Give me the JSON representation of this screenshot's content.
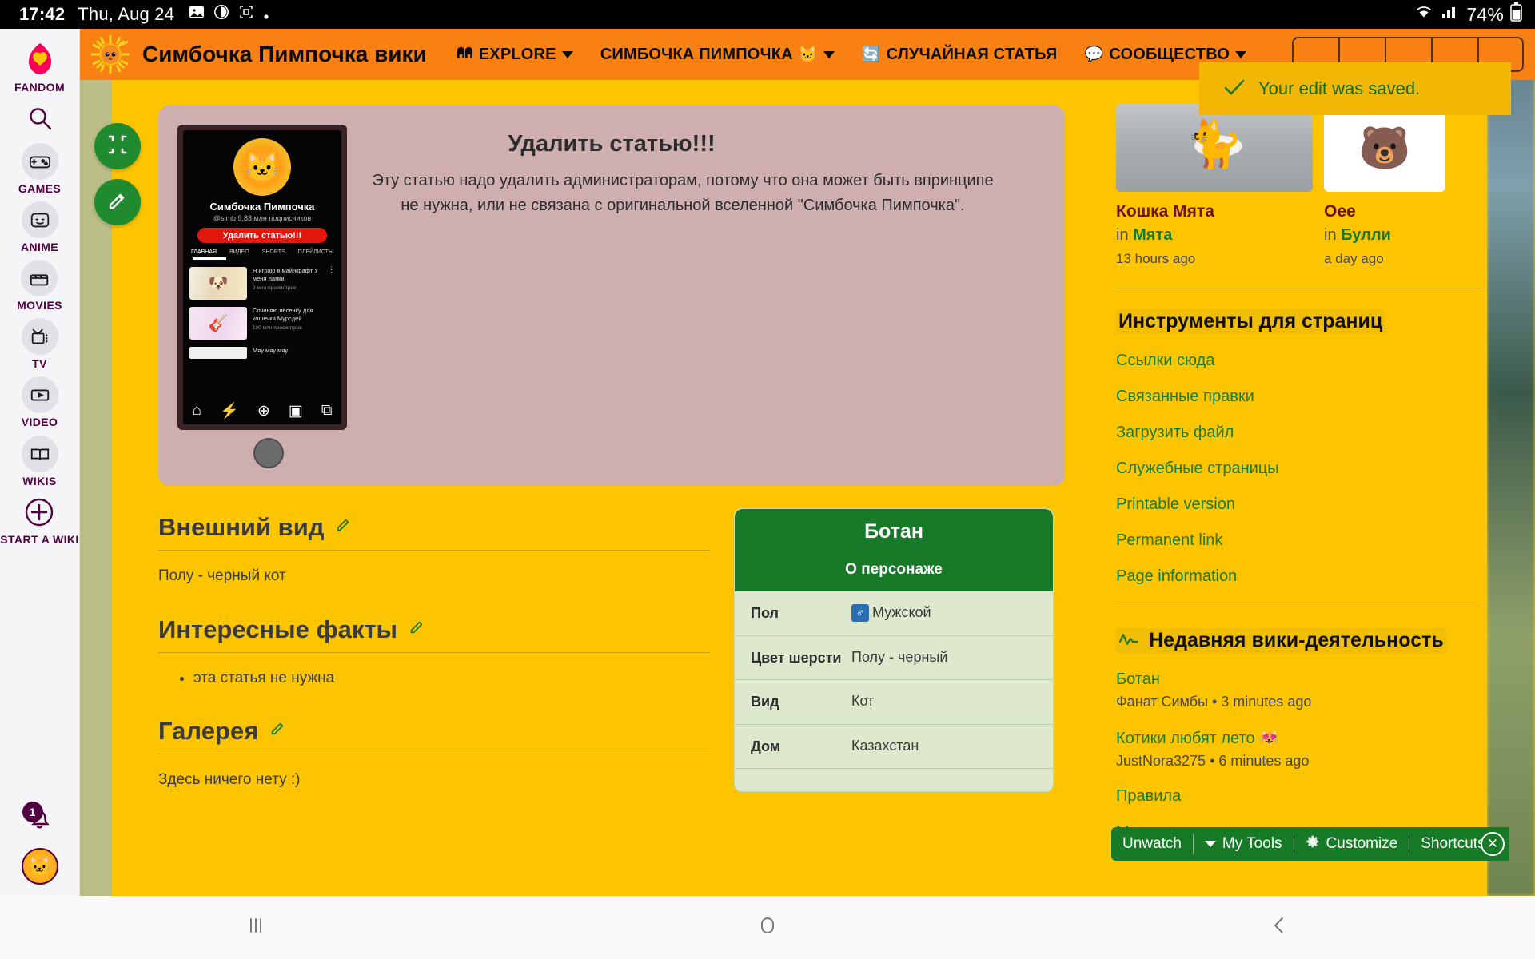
{
  "status_bar": {
    "time": "17:42",
    "date": "Thu, Aug 24",
    "icons": [
      "image-icon",
      "record-icon",
      "screenshot-icon",
      "dot-icon"
    ],
    "wifi": "wifi-icon",
    "signal": "signal-icon",
    "battery_pct": "74%",
    "battery": "battery-icon"
  },
  "global_rail": {
    "brand": "FANDOM",
    "search": "search-icon",
    "items": [
      {
        "label": "GAMES",
        "icon": "gamepad-icon"
      },
      {
        "label": "ANIME",
        "icon": "robot-face-icon"
      },
      {
        "label": "MOVIES",
        "icon": "clapperboard-icon"
      },
      {
        "label": "TV",
        "icon": "television-icon"
      },
      {
        "label": "VIDEO",
        "icon": "video-player-icon"
      },
      {
        "label": "WIKIS",
        "icon": "open-book-icon"
      }
    ],
    "start_wiki": "START A WIKI",
    "notification_count": "1",
    "avatar": "user-avatar"
  },
  "wiki_nav": {
    "logo": "wiki-logo-cat-sun",
    "title": "Симбочка Пимпочка вики",
    "links": [
      {
        "label": "EXPLORE",
        "icon": "explore-icon",
        "emoji": "",
        "caret": true
      },
      {
        "label": "СИМБОЧКА ПИМПОЧКА",
        "icon": "",
        "emoji": "🐱",
        "caret": true
      },
      {
        "label": "СЛУЧАЙНАЯ СТАТЬЯ",
        "icon": "",
        "emoji": "🔄",
        "caret": false
      },
      {
        "label": "СООБЩЕСТВО",
        "icon": "",
        "emoji": "💬",
        "caret": true
      }
    ]
  },
  "toast": {
    "icon": "check-icon",
    "message": "Your edit was saved."
  },
  "fabs": [
    {
      "name": "collapse-icon"
    },
    {
      "name": "edit-pencil-icon"
    }
  ],
  "article": {
    "delete_banner": {
      "title": "Удалить статью!!!",
      "text": "Эту статью надо удалить администраторам, потому что она может быть впринципе не нужна, или не связана с оригинальной вселенной \"Симбочка Пимпочка\".",
      "phone": {
        "channel_name": "Симбочка Пимпочка",
        "subs": "@simb 9,83 млн подписчиков",
        "button": "Удалить статью!!!",
        "tabs": [
          "ГЛАВНАЯ",
          "ВИДЕО",
          "SHORTS",
          "ПЛЕЙЛИСТЫ"
        ],
        "videos": [
          {
            "title": "Я играю в майнкрафт У меня лапки",
            "views": "9 млн просмотров"
          },
          {
            "title": "Сочиняю песенку для кошечки Мурсдей",
            "views": "100 млн просмотров"
          },
          {
            "title": "Мяу мяу мяу",
            "views": ""
          }
        ],
        "nav_icons": [
          "home-icon",
          "shorts-icon",
          "add-icon",
          "subscriptions-icon",
          "library-icon"
        ]
      }
    },
    "sections": [
      {
        "heading": "Внешний вид",
        "edit_icon": "pencil-icon",
        "body": "Полу - черный кот",
        "bullets": []
      },
      {
        "heading": "Интересные факты",
        "edit_icon": "pencil-icon",
        "body": "",
        "bullets": [
          "эта статья не нужна"
        ]
      },
      {
        "heading": "Галерея",
        "edit_icon": "pencil-icon",
        "body": "Здесь ничего нету :)",
        "bullets": []
      }
    ],
    "infobox": {
      "title": "Ботан",
      "subtitle": "О персонаже",
      "rows": [
        {
          "key": "Пол",
          "value": "Мужской",
          "icon": "male-symbol-icon"
        },
        {
          "key": "Цвет шерсти",
          "value": "Полу - черный",
          "icon": ""
        },
        {
          "key": "Вид",
          "value": "Кот",
          "icon": ""
        },
        {
          "key": "Дом",
          "value": "Казахстан",
          "icon": ""
        }
      ]
    }
  },
  "right_rail": {
    "cards": [
      {
        "title": "Кошка Мята",
        "in_prefix": "in",
        "in_wiki": "Мята",
        "time": "13 hours ago",
        "thumb": "cat-photo"
      },
      {
        "title": "Оее",
        "in_prefix": "in",
        "in_wiki": "Булли",
        "time": "a day ago",
        "thumb": "white-photo"
      }
    ],
    "page_tools": {
      "heading": "Инструменты для страниц",
      "links": [
        "Ссылки сюда",
        "Связанные правки",
        "Загрузить файл",
        "Служебные страницы",
        "Printable version",
        "Permanent link",
        "Page information"
      ]
    },
    "recent_activity": {
      "icon": "activity-pulse-icon",
      "heading": "Недавняя вики-деятельность",
      "items": [
        {
          "title": "Ботан",
          "meta": "Фанат Симбы • 3 minutes ago"
        },
        {
          "title": "Котики любят лето 😻",
          "meta": "JustNora3275 • 6 minutes ago"
        },
        {
          "title": "Правила",
          "meta": ""
        },
        {
          "title": "Мята",
          "meta": ""
        }
      ]
    }
  },
  "wiki_toolbar": {
    "items": [
      {
        "label": "Unwatch",
        "icon": ""
      },
      {
        "label": "My Tools",
        "icon": "caret-down-icon"
      },
      {
        "label": "Customize",
        "icon": "gear-icon"
      },
      {
        "label": "Shortcuts",
        "icon": ""
      }
    ],
    "close": "close-icon"
  },
  "android_nav": {
    "recents": "recents-icon",
    "home": "home-icon",
    "back": "back-icon"
  }
}
